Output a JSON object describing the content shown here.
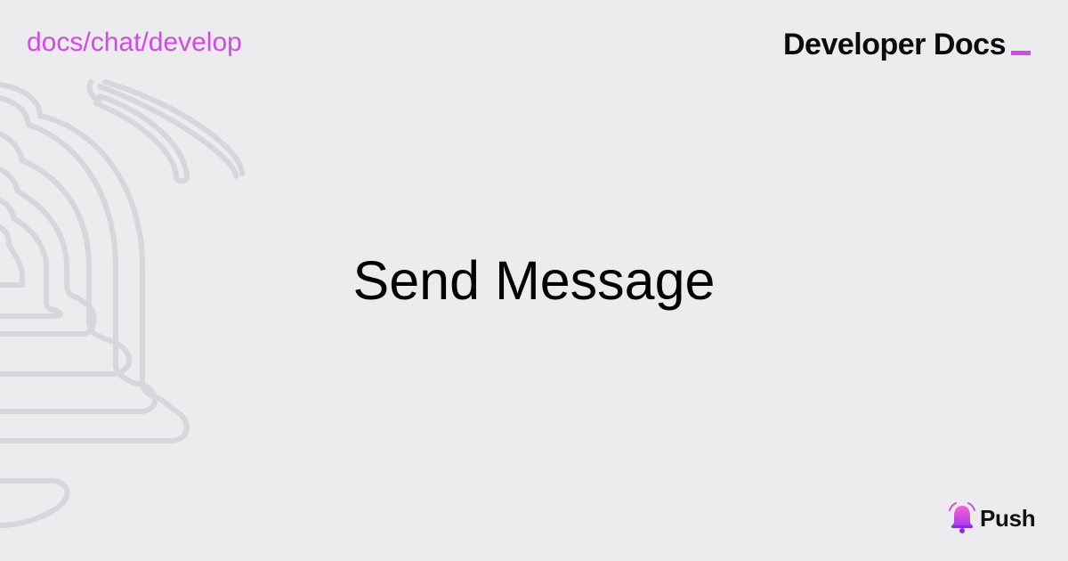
{
  "header": {
    "breadcrumb": "docs/chat/develop",
    "brand_title": "Developer Docs"
  },
  "main": {
    "page_title": "Send Message"
  },
  "footer": {
    "logo_label": "Push"
  },
  "icons": {
    "background": "bell-outline-icon",
    "logo": "push-bell-icon",
    "cursor": "cursor-underscore-icon"
  },
  "colors": {
    "background": "#ececee",
    "accent": "#d548ec",
    "text": "#0b0b0b",
    "art_stroke": "#d6d6dc"
  }
}
